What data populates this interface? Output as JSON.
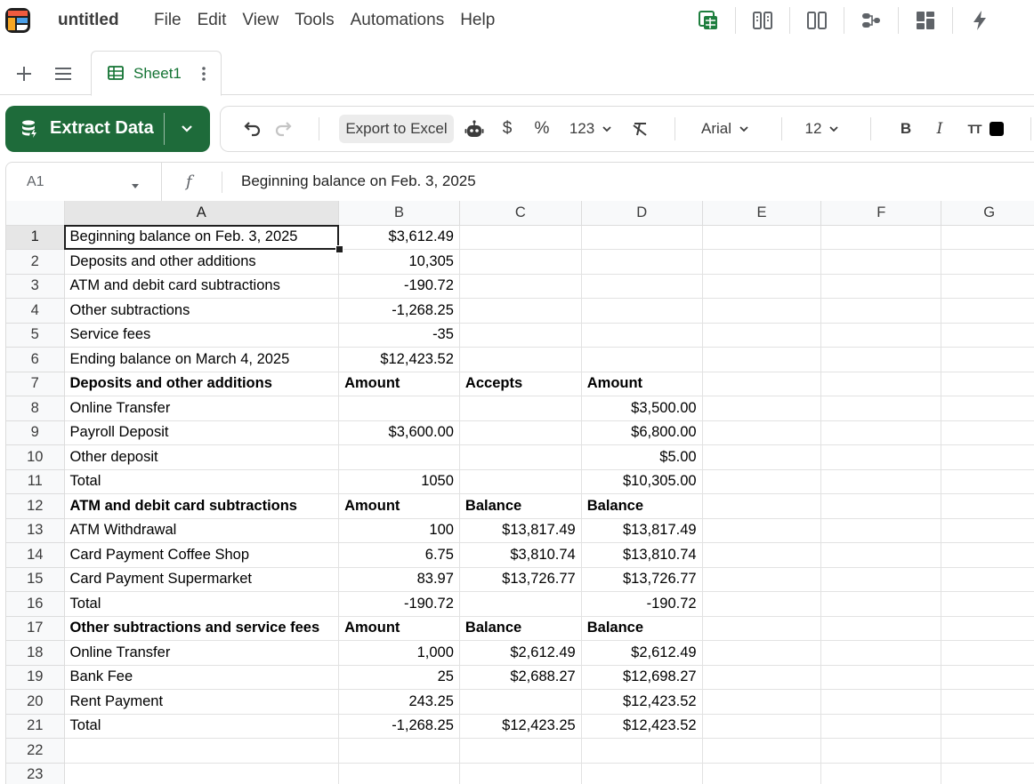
{
  "app": {
    "title": "untitled",
    "menu": [
      "File",
      "Edit",
      "View",
      "Tools",
      "Automations",
      "Help"
    ]
  },
  "top_icons": [
    "sheet-green-icon",
    "columns-compare-icon",
    "split-view-icon",
    "flow-icon",
    "dashboard-icon",
    "lightning-icon"
  ],
  "tabs": {
    "sheets": [
      {
        "label": "Sheet1",
        "active": true
      }
    ]
  },
  "toolbar": {
    "extract_label": "Extract Data",
    "export_label": "Export to Excel",
    "currency": "$",
    "percent": "%",
    "number_format": "123",
    "font": "Arial",
    "font_size": "12",
    "bold": "B",
    "italic": "I",
    "text_size": "TT",
    "accent_color": "#1e6b3a"
  },
  "formula_bar": {
    "cell_ref": "A1",
    "fx": "f",
    "content": "Beginning balance on Feb. 3, 2025"
  },
  "grid": {
    "columns": [
      "A",
      "B",
      "C",
      "D",
      "E",
      "F",
      "G"
    ],
    "rows": [
      {
        "n": "1",
        "cells": [
          "Beginning balance on Feb. 3, 2025",
          "$3,612.49",
          "",
          "",
          "",
          "",
          ""
        ]
      },
      {
        "n": "2",
        "cells": [
          "Deposits and other additions",
          "10,305",
          "",
          "",
          "",
          "",
          ""
        ]
      },
      {
        "n": "3",
        "cells": [
          "ATM and debit card subtractions",
          "-190.72",
          "",
          "",
          "",
          "",
          ""
        ]
      },
      {
        "n": "4",
        "cells": [
          "Other subtractions",
          "-1,268.25",
          "",
          "",
          "",
          "",
          ""
        ]
      },
      {
        "n": "5",
        "cells": [
          "Service fees",
          "-35",
          "",
          "",
          "",
          "",
          ""
        ]
      },
      {
        "n": "6",
        "cells": [
          "Ending balance on March 4, 2025",
          "$12,423.52",
          "",
          "",
          "",
          "",
          ""
        ]
      },
      {
        "n": "7",
        "bold": true,
        "cells": [
          "Deposits and other additions",
          "Amount",
          "Accepts",
          "Amount",
          "",
          "",
          ""
        ]
      },
      {
        "n": "8",
        "cells": [
          "Online Transfer",
          "",
          "",
          "$3,500.00",
          "",
          "",
          ""
        ]
      },
      {
        "n": "9",
        "cells": [
          "Payroll Deposit",
          "$3,600.00",
          "",
          "$6,800.00",
          "",
          "",
          ""
        ]
      },
      {
        "n": "10",
        "cells": [
          "Other deposit",
          "",
          "",
          "$5.00",
          "",
          "",
          ""
        ]
      },
      {
        "n": "11",
        "cells": [
          "Total",
          "1050",
          "",
          "$10,305.00",
          "",
          "",
          ""
        ]
      },
      {
        "n": "12",
        "bold": true,
        "cells": [
          "ATM and debit card subtractions",
          "Amount",
          "Balance",
          "Balance",
          "",
          "",
          ""
        ]
      },
      {
        "n": "13",
        "cells": [
          "ATM Withdrawal",
          "100",
          "$13,817.49",
          "$13,817.49",
          "",
          "",
          ""
        ]
      },
      {
        "n": "14",
        "cells": [
          "Card Payment Coffee Shop",
          "6.75",
          "$3,810.74",
          "$13,810.74",
          "",
          "",
          ""
        ]
      },
      {
        "n": "15",
        "cells": [
          "Card Payment Supermarket",
          "83.97",
          "$13,726.77",
          "$13,726.77",
          "",
          "",
          ""
        ]
      },
      {
        "n": "16",
        "cells": [
          "Total",
          "-190.72",
          "",
          "-190.72",
          "",
          "",
          ""
        ]
      },
      {
        "n": "17",
        "bold": true,
        "cells": [
          "Other subtractions and service fees",
          "Amount",
          "Balance",
          "Balance",
          "",
          "",
          ""
        ]
      },
      {
        "n": "18",
        "cells": [
          "Online Transfer",
          "1,000",
          "$2,612.49",
          "$2,612.49",
          "",
          "",
          ""
        ]
      },
      {
        "n": "19",
        "cells": [
          "Bank Fee",
          "25",
          "$2,688.27",
          "$12,698.27",
          "",
          "",
          ""
        ]
      },
      {
        "n": "20",
        "cells": [
          "Rent Payment",
          "243.25",
          "",
          "$12,423.52",
          "",
          "",
          ""
        ]
      },
      {
        "n": "21",
        "cells": [
          "Total",
          "-1,268.25",
          "$12,423.25",
          "$12,423.52",
          "",
          "",
          ""
        ]
      },
      {
        "n": "22",
        "cells": [
          "",
          "",
          "",
          "",
          "",
          "",
          ""
        ]
      },
      {
        "n": "23",
        "cells": [
          "",
          "",
          "",
          "",
          "",
          "",
          ""
        ]
      }
    ]
  }
}
